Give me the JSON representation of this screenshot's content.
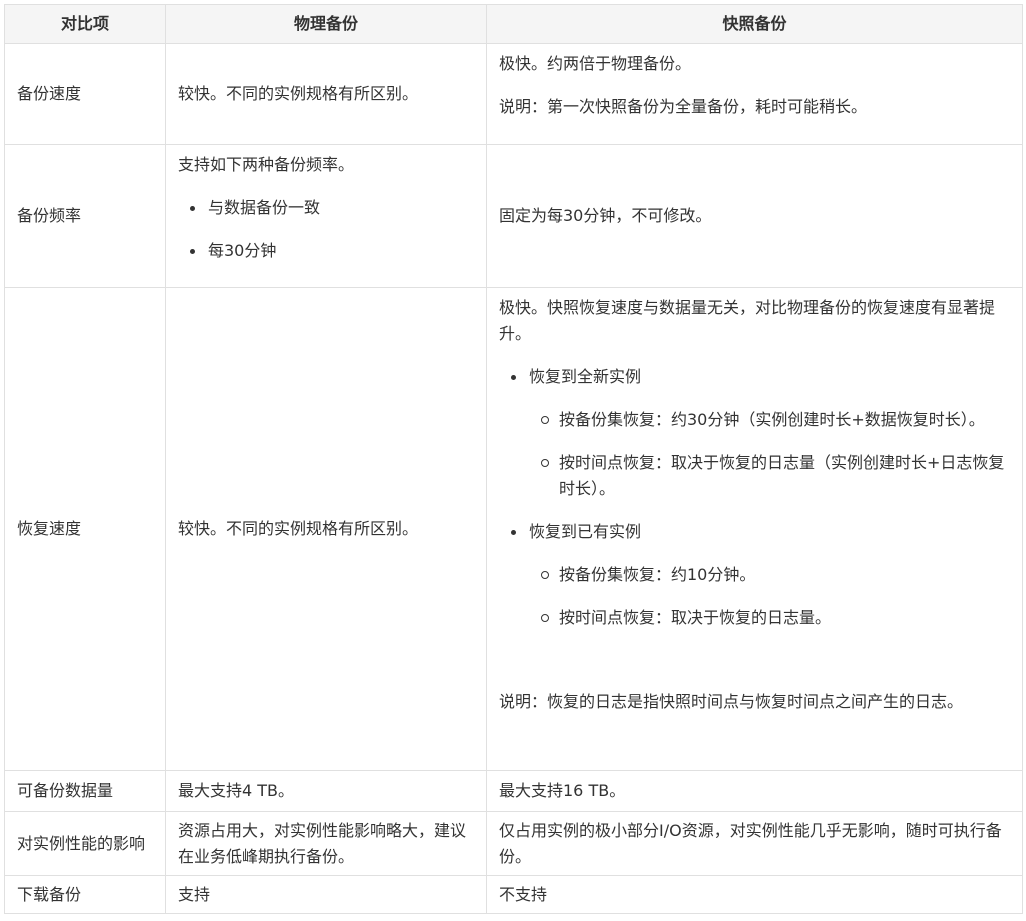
{
  "table": {
    "headers": [
      "对比项",
      "物理备份",
      "快照备份"
    ],
    "rows": {
      "backup_speed": {
        "item": "备份速度",
        "physical": "较快。不同的实例规格有所区别。",
        "snapshot_main": "极快。约两倍于物理备份。",
        "snapshot_note": "说明：第一次快照备份为全量备份，耗时可能稍长。"
      },
      "backup_frequency": {
        "item": "备份频率",
        "physical_intro": "支持如下两种备份频率。",
        "physical_options": [
          "与数据备份一致",
          "每30分钟"
        ],
        "snapshot": "固定为每30分钟，不可修改。"
      },
      "restore_speed": {
        "item": "恢复速度",
        "physical": "较快。不同的实例规格有所区别。",
        "snapshot_intro": "极快。快照恢复速度与数据量无关，对比物理备份的恢复速度有显著提升。",
        "new_instance": {
          "label": "恢复到全新实例",
          "items": [
            "按备份集恢复：约30分钟（实例创建时长+数据恢复时长）。",
            "按时间点恢复：取决于恢复的日志量（实例创建时长+日志恢复时长）。"
          ]
        },
        "existing_instance": {
          "label": "恢复到已有实例",
          "items": [
            "按备份集恢复：约10分钟。",
            "按时间点恢复：取决于恢复的日志量。"
          ]
        },
        "snapshot_note": "说明：恢复的日志是指快照时间点与恢复时间点之间产生的日志。"
      },
      "data_volume": {
        "item": "可备份数据量",
        "physical": "最大支持4 TB。",
        "snapshot": "最大支持16 TB。"
      },
      "performance": {
        "item": "对实例性能的影响",
        "physical": "资源占用大，对实例性能影响略大，建议在业务低峰期执行备份。",
        "snapshot": "仅占用实例的极小部分I/O资源，对实例性能几乎无影响，随时可执行备份。"
      },
      "download": {
        "item": "下载备份",
        "physical": "支持",
        "snapshot": "不支持"
      }
    }
  }
}
